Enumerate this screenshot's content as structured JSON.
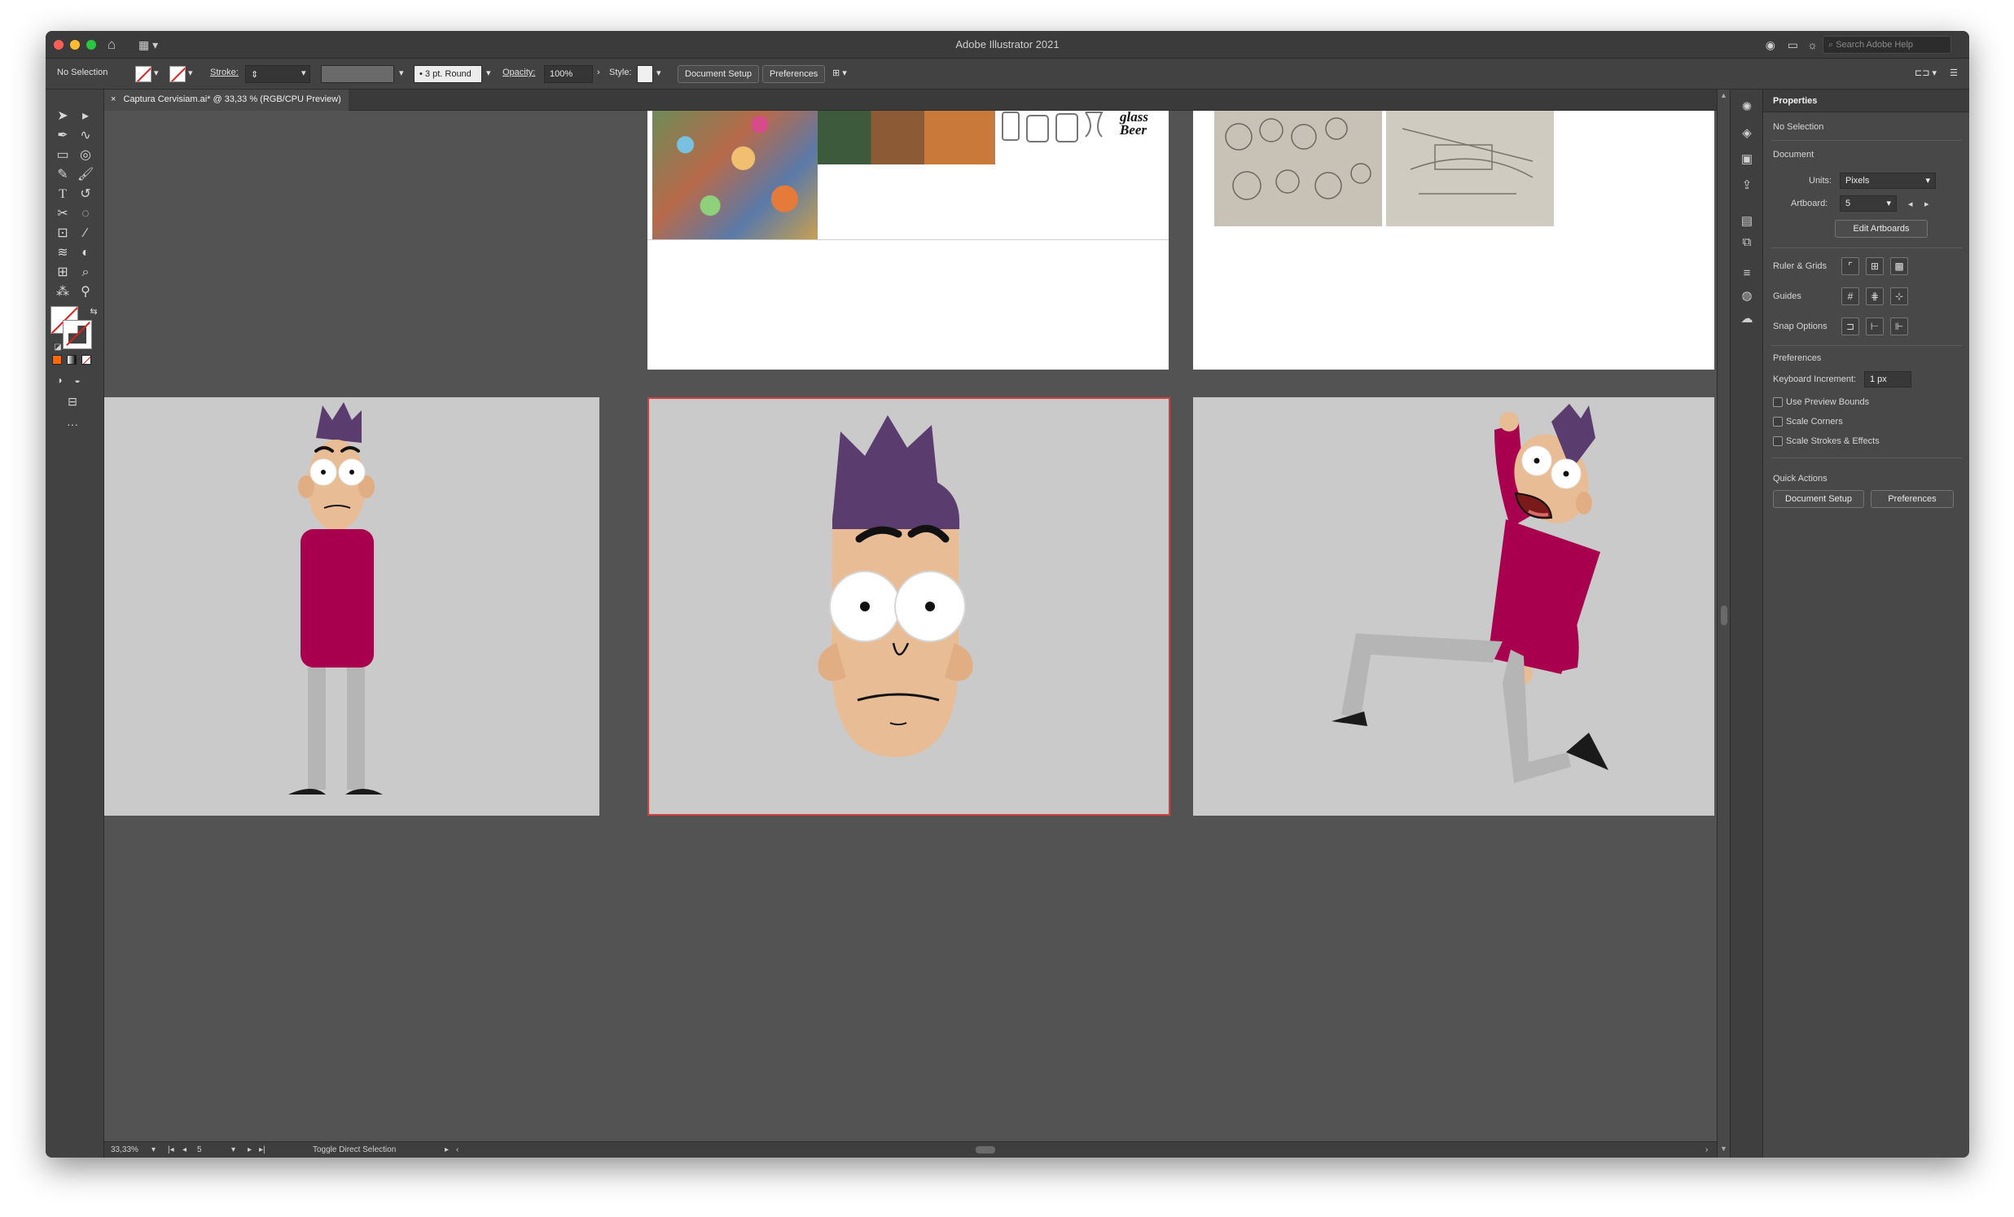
{
  "window": {
    "title": "Adobe Illustrator 2021"
  },
  "titlebar": {
    "search_placeholder": "Search Adobe Help"
  },
  "control_bar": {
    "selection_status": "No Selection",
    "stroke_label": "Stroke:",
    "brush_value": "3 pt. Round",
    "opacity_label": "Opacity:",
    "opacity_value": "100%",
    "style_label": "Style:",
    "document_setup": "Document Setup",
    "preferences": "Preferences"
  },
  "document_tab": {
    "label": "Captura Cervisiam.ai* @ 33,33 % (RGB/CPU Preview)"
  },
  "artboards": {
    "beer_logo": "glass Beer"
  },
  "status_bar": {
    "zoom": "33,33%",
    "artboard_number": "5",
    "tool_hint": "Toggle Direct Selection"
  },
  "properties_panel": {
    "tab_label": "Properties",
    "selection_status": "No Selection",
    "document_heading": "Document",
    "units_label": "Units:",
    "units_value": "Pixels",
    "artboard_label": "Artboard:",
    "artboard_value": "5",
    "edit_artboards": "Edit Artboards",
    "ruler_grids": "Ruler & Grids",
    "guides": "Guides",
    "snap_options": "Snap Options",
    "preferences_heading": "Preferences",
    "keyboard_increment_label": "Keyboard Increment:",
    "keyboard_increment_value": "1 px",
    "use_preview_bounds": "Use Preview Bounds",
    "scale_corners": "Scale Corners",
    "scale_strokes_effects": "Scale Strokes & Effects",
    "quick_actions": "Quick Actions",
    "document_setup": "Document Setup",
    "preferences": "Preferences"
  },
  "colors": {
    "window_bg": "#535353",
    "artboard_gray": "#cacaca",
    "shirt": "#a8004f",
    "hair": "#5a3d6e",
    "skin": "#e8bc95",
    "pants": "#b5b5b5",
    "selected_artboard_border": "#d04040"
  }
}
